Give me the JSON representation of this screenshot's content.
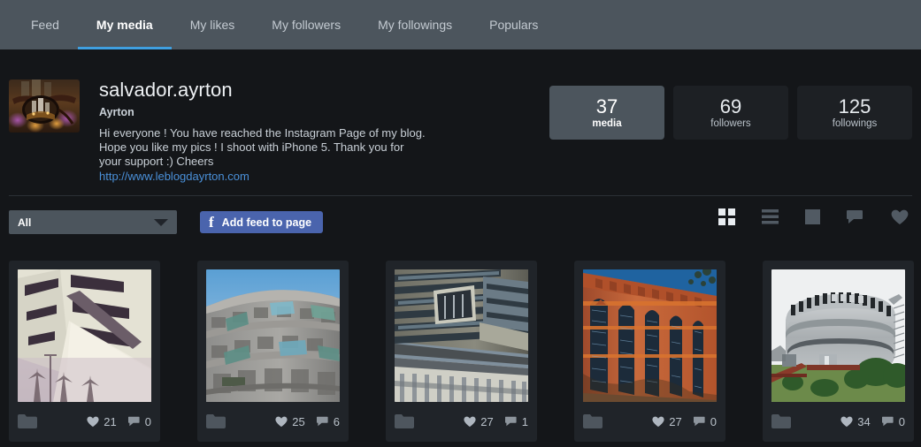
{
  "nav": {
    "tabs": [
      {
        "label": "Feed",
        "active": false
      },
      {
        "label": "My media",
        "active": true
      },
      {
        "label": "My likes",
        "active": false
      },
      {
        "label": "My followers",
        "active": false
      },
      {
        "label": "My followings",
        "active": false
      },
      {
        "label": "Populars",
        "active": false
      }
    ]
  },
  "profile": {
    "username": "salvador.ayrton",
    "realname": "Ayrton",
    "bio": "Hi everyone ! You have reached the Instagram Page of my blog. Hope you like my pics ! I shoot with iPhone 5. Thank you for your support :) Cheers",
    "link": "http://www.leblogdayrton.com",
    "avatar_alt": "profile-avatar"
  },
  "stats": [
    {
      "value": "37",
      "label": "media",
      "active": true
    },
    {
      "value": "69",
      "label": "followers",
      "active": false
    },
    {
      "value": "125",
      "label": "followings",
      "active": false
    }
  ],
  "toolbar": {
    "filter_value": "All",
    "fb_button_label": "Add feed to page",
    "fb_icon": "facebook-f-icon",
    "view_modes": [
      {
        "name": "grid-view-icon",
        "active": true
      },
      {
        "name": "list-view-icon",
        "active": false
      },
      {
        "name": "single-view-icon",
        "active": false
      },
      {
        "name": "comments-view-icon",
        "active": false
      },
      {
        "name": "likes-view-icon",
        "active": false
      }
    ]
  },
  "media": [
    {
      "alt": "white-angular-building",
      "likes": "21",
      "comments": "0"
    },
    {
      "alt": "grey-stone-building",
      "likes": "25",
      "comments": "6"
    },
    {
      "alt": "dark-striped-building",
      "likes": "27",
      "comments": "1"
    },
    {
      "alt": "red-brick-arched-building",
      "likes": "27",
      "comments": "0"
    },
    {
      "alt": "curved-silver-building",
      "likes": "34",
      "comments": "0"
    }
  ],
  "colors": {
    "header": "#4c555d",
    "body": "#141619",
    "accent_blue": "#3f9fe0",
    "link_blue": "#4a90d9",
    "facebook_blue": "#4a64ad",
    "card": "#202429"
  }
}
